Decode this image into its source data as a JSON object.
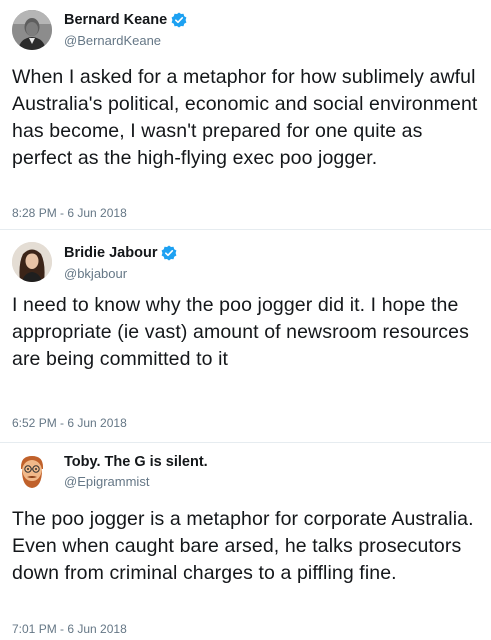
{
  "tweets": [
    {
      "display_name": "Bernard Keane",
      "verified": true,
      "handle": "@BernardKeane",
      "text": "When I asked for a metaphor for how sublimely awful Australia's political, economic and social environment has become, I wasn't prepared for one quite as perfect as the high-flying exec poo jogger.",
      "timestamp": "8:28 PM - 6 Jun 2018",
      "avatar": "man-grayscale-photo-avatar"
    },
    {
      "display_name": "Bridie Jabour",
      "verified": true,
      "handle": "@bkjabour",
      "text": "I need to know why the poo jogger did it. I hope the appropriate (ie vast) amount of newsroom resources are being committed to it",
      "timestamp": "6:52 PM - 6 Jun 2018",
      "avatar": "woman-dark-hair-photo-avatar"
    },
    {
      "display_name": "Toby. The G is silent.",
      "verified": false,
      "handle": "@Epigrammist",
      "text": "The poo jogger is a metaphor for corporate Australia. Even when caught bare arsed, he talks prosecutors down from criminal charges to a piffling fine.",
      "timestamp": "7:01 PM - 6 Jun 2018",
      "avatar": "bearded-cartoon-emoji-avatar"
    }
  ],
  "colors": {
    "verified_blue": "#1da1f2",
    "secondary_text": "#657786",
    "primary_text": "#14171a",
    "divider": "#e6ecf0"
  },
  "icons": {
    "verified": "verified-badge-icon"
  }
}
